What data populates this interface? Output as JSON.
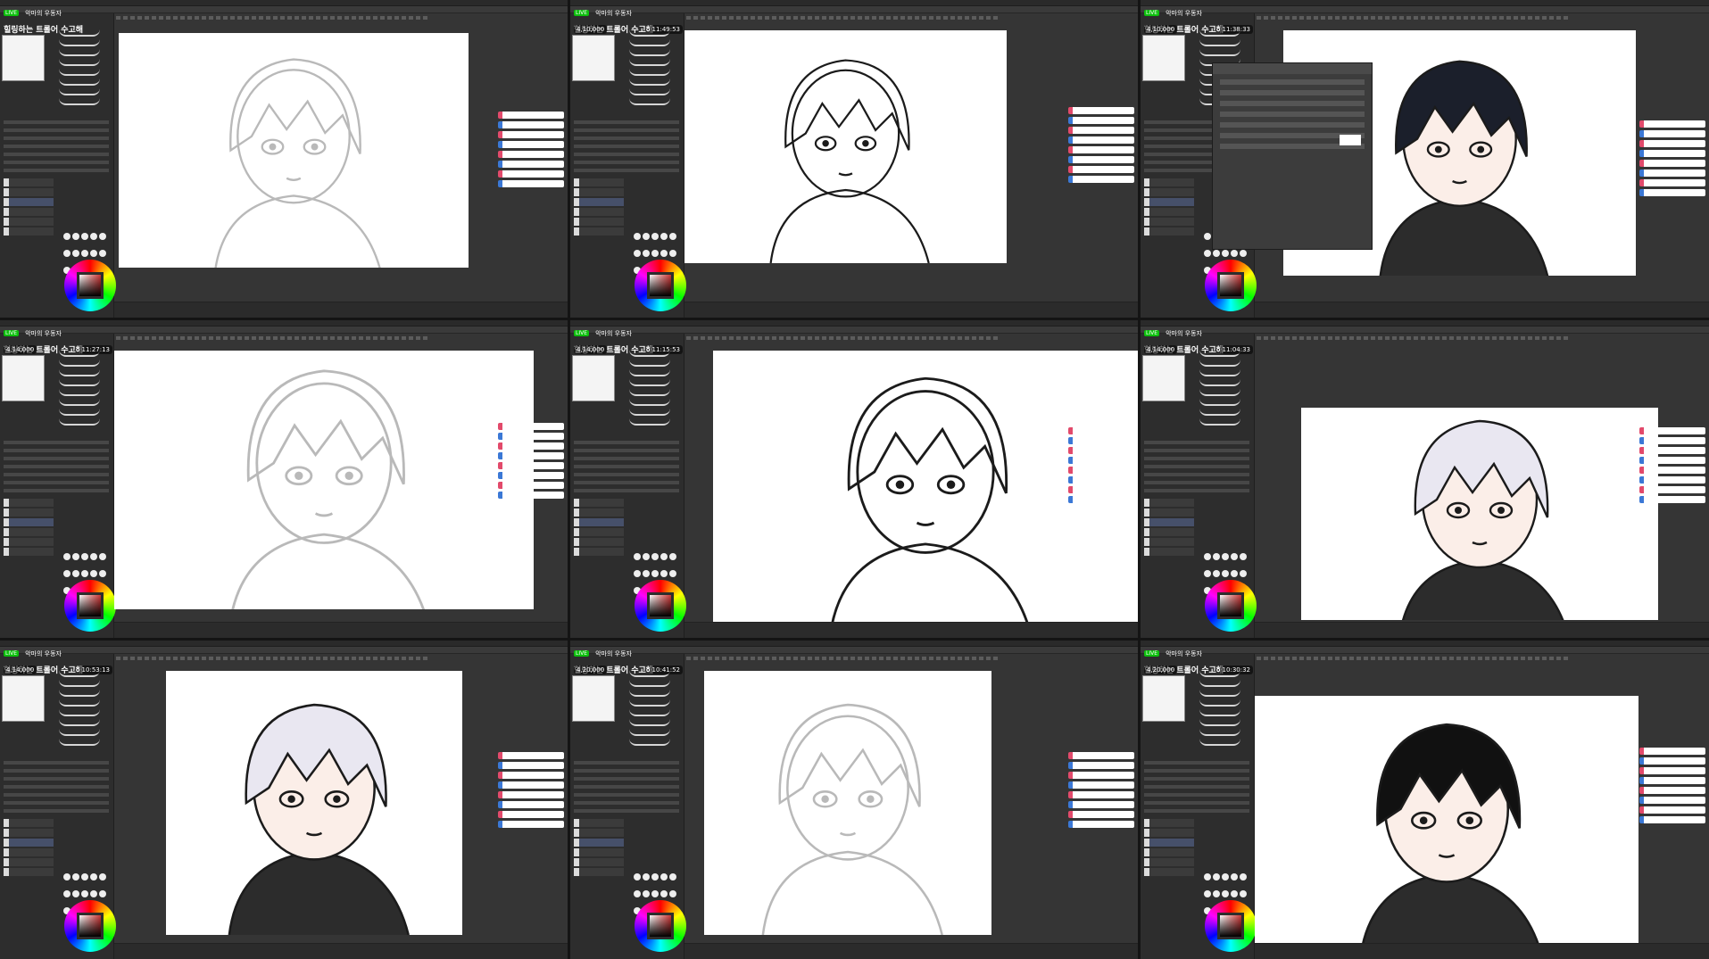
{
  "panels": [
    {
      "badge": "LIVE",
      "streamer": "악마의 우동자",
      "title": "힐링하는 트롤어 수고해",
      "viewers": "",
      "clock": "",
      "canvas_style": "sketch"
    },
    {
      "badge": "LIVE",
      "streamer": "악마의 우동자",
      "title": "힐링하는 트롤어 수고해",
      "viewers": "4,10,000",
      "clock": "11:49:53",
      "canvas_style": "lineart"
    },
    {
      "badge": "LIVE",
      "streamer": "악마의 우동자",
      "title": "힐링하는 트롤어 수고해",
      "viewers": "4,10,000",
      "clock": "11:38:33",
      "canvas_style": "color-dark"
    },
    {
      "badge": "LIVE",
      "streamer": "악마의 우동자",
      "title": "힐링하는 트롤어 수고해",
      "viewers": "4,14,000",
      "clock": "11:27:13",
      "canvas_style": "sketch2"
    },
    {
      "badge": "LIVE",
      "streamer": "악마의 우동자",
      "title": "힐링하는 트롤어 수고해",
      "viewers": "4,14,000",
      "clock": "11:15:53",
      "canvas_style": "lineart2"
    },
    {
      "badge": "LIVE",
      "streamer": "악마의 우동자",
      "title": "힐링하는 트롤어 수고해",
      "viewers": "4,14,000",
      "clock": "11:04:33",
      "canvas_style": "color-white"
    },
    {
      "badge": "LIVE",
      "streamer": "악마의 우동자",
      "title": "힐링하는 트롤어 수고해",
      "viewers": "4,14,000",
      "clock": "10:53:13",
      "canvas_style": "color-blush"
    },
    {
      "badge": "LIVE",
      "streamer": "악마의 우동자",
      "title": "힐링하는 트롤어 수고해",
      "viewers": "4,20,000",
      "clock": "10:41:52",
      "canvas_style": "sketch3"
    },
    {
      "badge": "LIVE",
      "streamer": "악마의 우동자",
      "title": "힐링하는 트롤어 수고해",
      "viewers": "4,20,000",
      "clock": "10:30:32",
      "canvas_style": "color-black"
    }
  ],
  "colors": {
    "ui_dark": "#2d2d2d",
    "ui_mid": "#353535",
    "canvas": "#ffffff",
    "live_badge": "#0cbf0c"
  }
}
